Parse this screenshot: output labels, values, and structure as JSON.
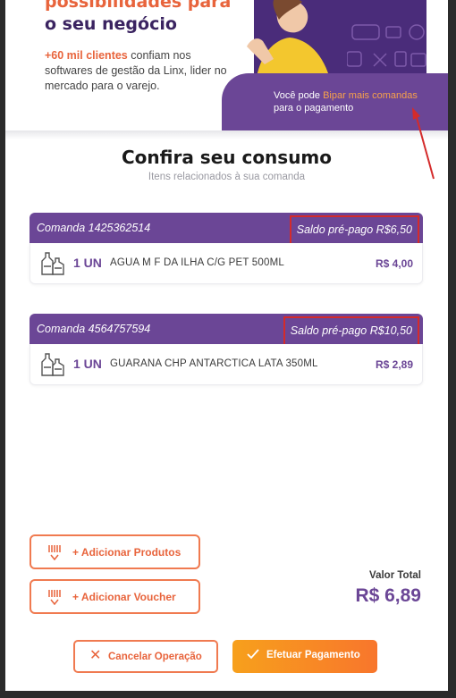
{
  "hero": {
    "title_line1": "possibilidades para",
    "title_line2": "o seu negócio",
    "desc_highlight": "+60 mil clientes",
    "desc_rest": " confiam nos softwares de gestão da Linx, lider no mercado para o varejo."
  },
  "promo": {
    "prefix": "Você pode ",
    "link": "Bipar mais comandas",
    "line2": "para o pagamento"
  },
  "page": {
    "title": "Confira seu consumo",
    "subtitle": "Itens relacionados à sua comanda"
  },
  "comandas": [
    {
      "name": "Comanda 1425362514",
      "saldo": "Saldo pré-pago R$6,50",
      "item": {
        "qty": "1 UN",
        "name": "AGUA M F DA ILHA C/G PET 500ML",
        "price": "R$ 4,00",
        "icon": "bottles-icon"
      }
    },
    {
      "name": "Comanda 4564757594",
      "saldo": "Saldo pré-pago R$10,50",
      "item": {
        "qty": "1 UN",
        "name": "GUARANA CHP ANTARCTICA LATA 350ML",
        "price": "R$ 2,89",
        "icon": "bottles-icon"
      }
    }
  ],
  "actions": {
    "add_products": "+ Adicionar Produtos",
    "add_voucher": "+ Adicionar Voucher",
    "cancel": "Cancelar Operação",
    "pay": "Efetuar Pagamento"
  },
  "total": {
    "label": "Valor Total",
    "value": "R$ 6,89"
  },
  "colors": {
    "brand_purple": "#6b4696",
    "accent_orange": "#e8643c",
    "annotation_red": "#d42b2b"
  }
}
